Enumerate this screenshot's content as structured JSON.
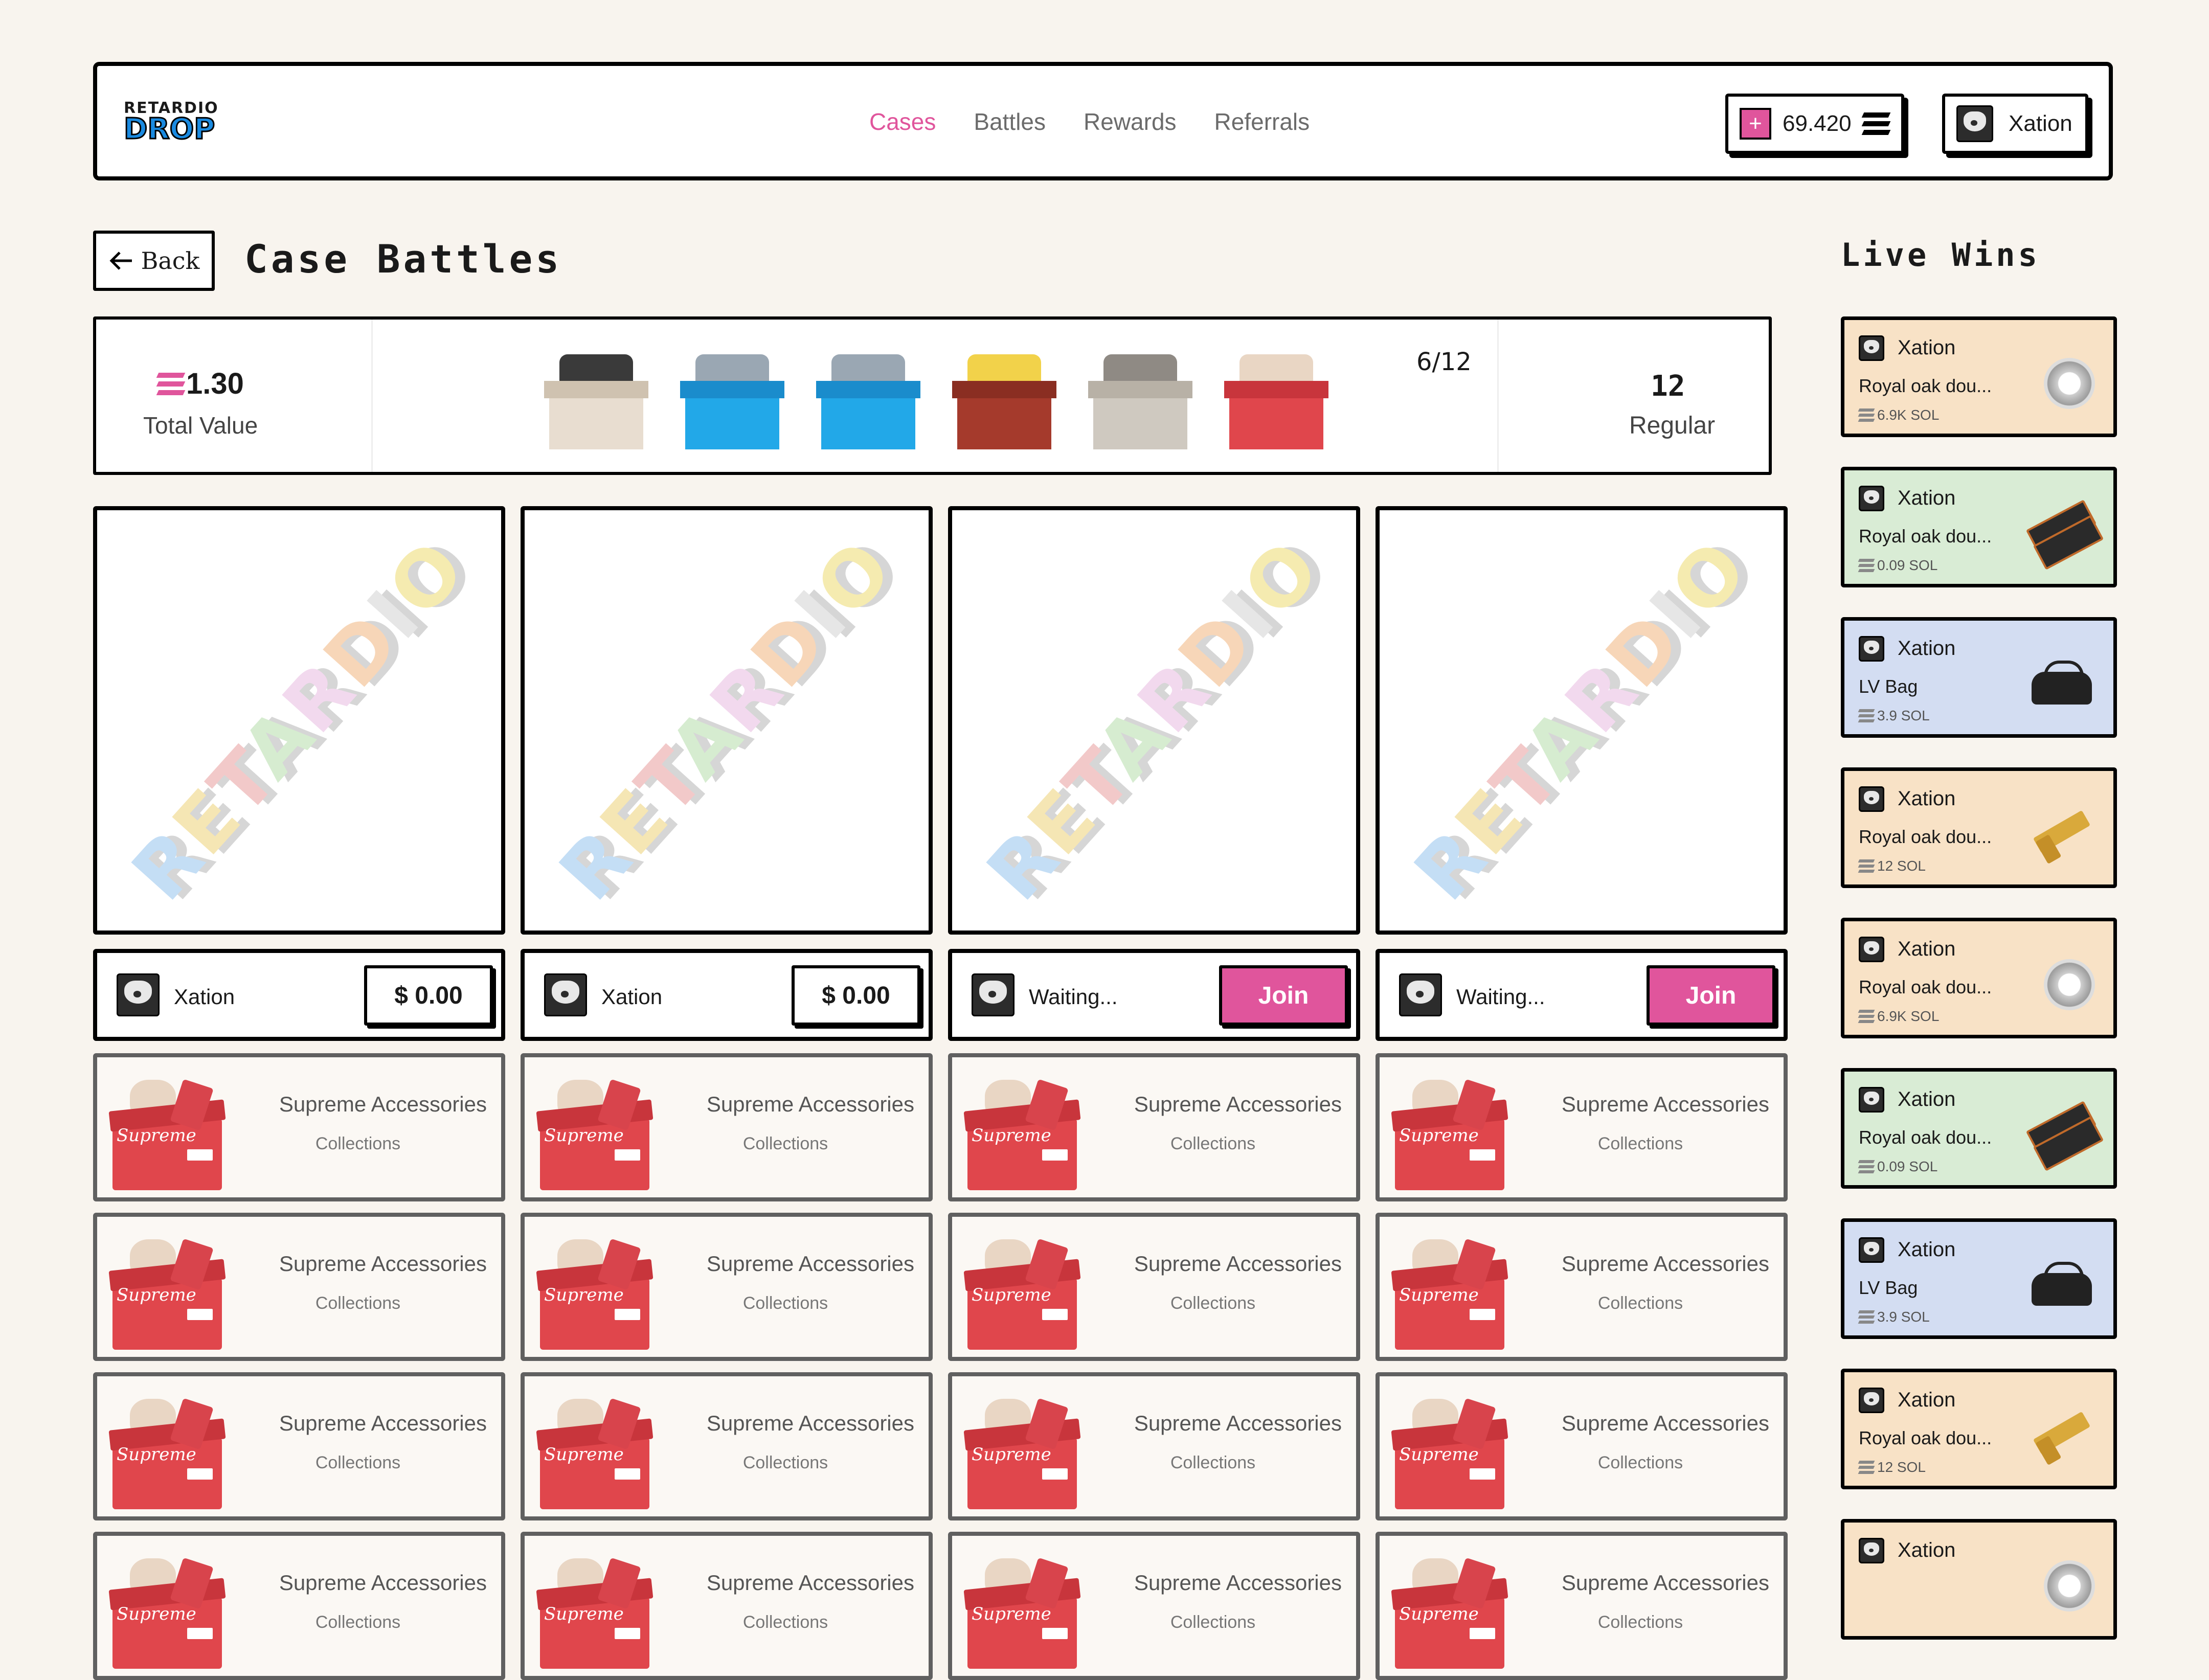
{
  "header": {
    "logo_top": "RETARDIO",
    "logo_bottom": "DROP",
    "nav": [
      "Cases",
      "Battles",
      "Rewards",
      "Referrals"
    ],
    "nav_active": "Cases",
    "balance": "69.420",
    "user": "Xation"
  },
  "title": {
    "back_label": "Back",
    "page_title": "Case Battles",
    "live_title": "Live Wins"
  },
  "summary": {
    "total_value": "1.30",
    "total_label": "Total Value",
    "case_count": "6/12",
    "mode_count": "12",
    "mode_label": "Regular",
    "cases": [
      {
        "name": "big-bank-case-icon",
        "body": "#e8ddd0",
        "lid": "#cfc2b0",
        "stuff": "#3a3a3a"
      },
      {
        "name": "urus-case-icon",
        "body": "#22a8e8",
        "lid": "#1a8ccc",
        "stuff": "#9aa7b3"
      },
      {
        "name": "urus-case-icon",
        "body": "#22a8e8",
        "lid": "#1a8ccc",
        "stuff": "#9aa7b3"
      },
      {
        "name": "bearbrick-case-icon",
        "body": "#a53a2c",
        "lid": "#8a2e22",
        "stuff": "#f2d24a"
      },
      {
        "name": "hypebox-case-icon",
        "body": "#cfc9c0",
        "lid": "#b8b1a6",
        "stuff": "#8f8a84"
      },
      {
        "name": "supreme-case-icon",
        "body": "#e0464c",
        "lid": "#c8353c",
        "stuff": "#e9d6c4"
      }
    ]
  },
  "watermark": "RETARDIO",
  "watermark_colors": [
    "#c4def5",
    "#f5e6b4",
    "#f2c9c9",
    "#d6ecd0",
    "#f2d9ee",
    "#f7d6b8",
    "#e6e6e6",
    "#f5ebb0"
  ],
  "players": [
    {
      "name": "Xation",
      "value": "$ 0.00",
      "action": "value"
    },
    {
      "name": "Xation",
      "value": "$ 0.00",
      "action": "value"
    },
    {
      "name": "Waiting...",
      "value": "Join",
      "action": "join"
    },
    {
      "name": "Waiting...",
      "value": "Join",
      "action": "join"
    }
  ],
  "case_card": {
    "title": "Supreme Accessories",
    "subtitle": "Collections",
    "image_text": "Supreme"
  },
  "live_wins": [
    {
      "user": "Xation",
      "item": "Royal oak dou...",
      "value": "6.9K SOL",
      "bg": "#f8e2c6",
      "thumb": "watch"
    },
    {
      "user": "Xation",
      "item": "Royal oak dou...",
      "value": "0.09 SOL",
      "bg": "#d9ecd5",
      "thumb": "tix"
    },
    {
      "user": "Xation",
      "item": "LV Bag",
      "value": "3.9 SOL",
      "bg": "#d3ddf2",
      "thumb": "bag"
    },
    {
      "user": "Xation",
      "item": "Royal oak dou...",
      "value": "12 SOL",
      "bg": "#f8e2c6",
      "thumb": "gun"
    },
    {
      "user": "Xation",
      "item": "Royal oak dou...",
      "value": "6.9K SOL",
      "bg": "#f8e2c6",
      "thumb": "watch"
    },
    {
      "user": "Xation",
      "item": "Royal oak dou...",
      "value": "0.09 SOL",
      "bg": "#d9ecd5",
      "thumb": "tix"
    },
    {
      "user": "Xation",
      "item": "LV Bag",
      "value": "3.9 SOL",
      "bg": "#d3ddf2",
      "thumb": "bag"
    },
    {
      "user": "Xation",
      "item": "Royal oak dou...",
      "value": "12 SOL",
      "bg": "#f8e2c6",
      "thumb": "gun"
    },
    {
      "user": "Xation",
      "item": "",
      "value": "",
      "bg": "#f8e2c6",
      "thumb": "watch"
    }
  ]
}
